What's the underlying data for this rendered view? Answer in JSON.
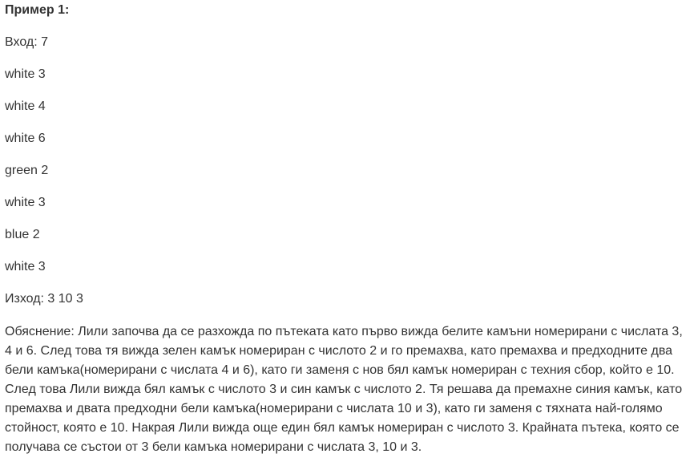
{
  "example": {
    "title": "Пример 1:",
    "lines": [
      "Вход: 7",
      "white 3",
      "white 4",
      "white 6",
      "green 2",
      "white 3",
      "blue 2",
      "white 3",
      "Изход: 3 10 3"
    ],
    "explanation": "Обяснение: Лили започва да се разхожда по пътеката като първо вижда белите камъни номерирани с числата 3, 4 и 6. След това тя вижда зелен камък номериран с числото 2 и го премахва, като премахва и предходните два бели камъка(номерирани с числата 4 и 6), като ги заменя с нов бял камък номериран с техния сбор, който е 10. След това Лили вижда бял камък с числото 3 и син камък с числото 2. Тя решава да премахне синия камък, като премахва и двата предходни бели камъка(номерирани с числата 10 и 3), като ги заменя с тяхната най-голямо стойност, която е 10. Накрая Лили вижда още един бял камък номериран с числото 3. Крайната пътека, която се получава се състои от 3 бели камъка номерирани с числата 3, 10 и 3."
  }
}
